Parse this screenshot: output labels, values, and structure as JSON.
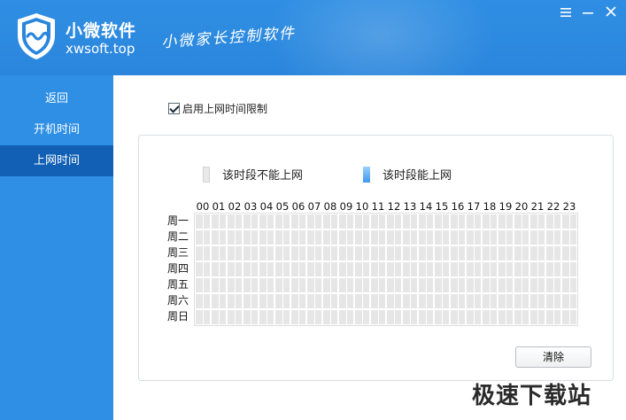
{
  "header": {
    "app_name": "小微软件",
    "app_site": "xwsoft.top",
    "slogan": "小微家长控制软件",
    "window_buttons": [
      "menu-icon",
      "minimize-icon",
      "close-icon"
    ]
  },
  "sidebar": {
    "items": [
      {
        "label": "返回"
      },
      {
        "label": "开机时间"
      },
      {
        "label": "上网时间"
      }
    ],
    "active_index": 2
  },
  "settings": {
    "enable_label": "启用上网时间限制",
    "enable_checked": true
  },
  "legend": {
    "blocked_label": "该时段不能上网",
    "allowed_label": "该时段能上网"
  },
  "schedule": {
    "hours": [
      "00",
      "01",
      "02",
      "03",
      "04",
      "05",
      "06",
      "07",
      "08",
      "09",
      "10",
      "11",
      "12",
      "13",
      "14",
      "15",
      "16",
      "17",
      "18",
      "19",
      "20",
      "21",
      "22",
      "23"
    ],
    "days": [
      "周一",
      "周二",
      "周三",
      "周四",
      "周五",
      "周六",
      "周日"
    ]
  },
  "buttons": {
    "clear_label": "清除"
  },
  "watermark": "极速下载站",
  "colors": {
    "header_bg": "#2f8ee3",
    "sidebar_bg": "#2e8fe4",
    "sidebar_active": "#1160b5",
    "cell_blocked": "#e6e6e6",
    "cell_allowed": "#3d98ee"
  }
}
